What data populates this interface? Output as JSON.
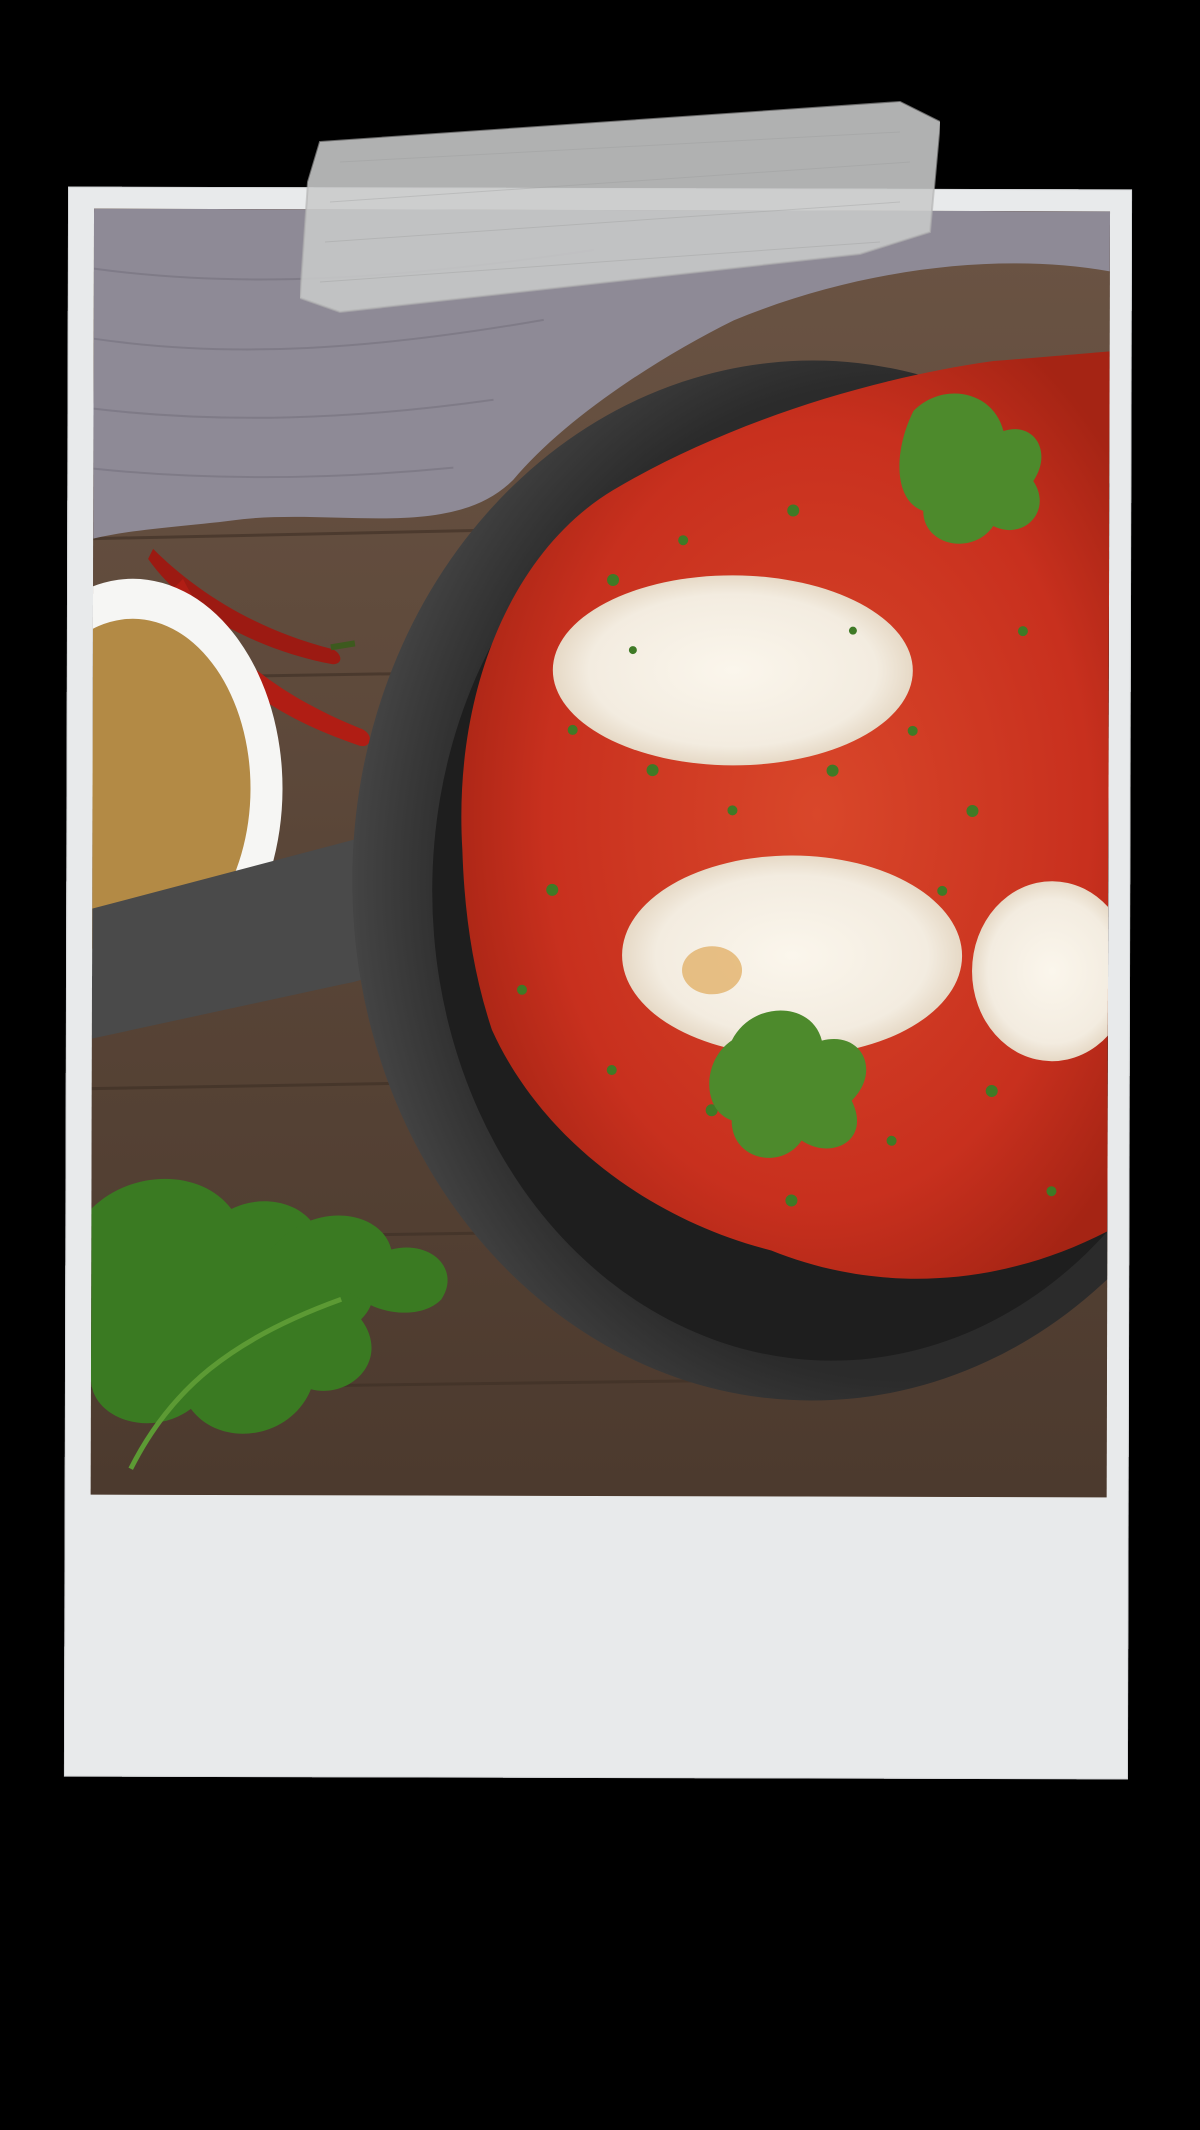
{
  "photo": {
    "subject_icons": [
      "tape-icon",
      "cloth-icon",
      "chili-icon",
      "spice-bowl-icon",
      "skillet-icon",
      "egg-icon",
      "parsley-icon"
    ]
  },
  "colors": {
    "background": "#000000",
    "frame": "#e8eaeb",
    "sauce": "#c8301e",
    "egg_white": "#f6f1e6",
    "parsley": "#3f7a26",
    "pan": "#2a2a2a",
    "wood": "#5a4638",
    "cloth": "#8e8a96",
    "spice": "#b38a45"
  },
  "caption": {
    "text": ""
  }
}
